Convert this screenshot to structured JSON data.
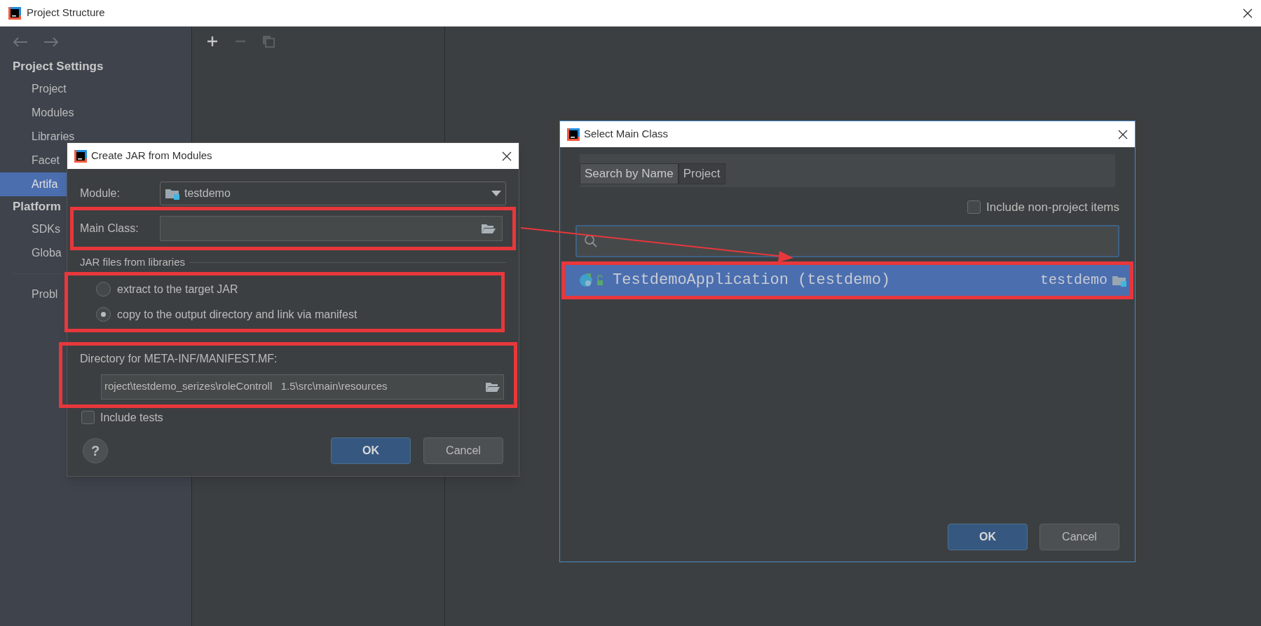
{
  "window": {
    "title": "Project Structure"
  },
  "sidebar": {
    "sections": [
      {
        "title": "Project Settings",
        "items": [
          {
            "label": "Project",
            "selected": false
          },
          {
            "label": "Modules",
            "selected": false
          },
          {
            "label": "Libraries",
            "selected": false
          },
          {
            "label": "Facet",
            "selected": false
          },
          {
            "label": "Artifa",
            "selected": true
          }
        ]
      },
      {
        "title": "Platform",
        "items": [
          {
            "label": "SDKs",
            "selected": false
          },
          {
            "label": "Globa",
            "selected": false
          }
        ]
      }
    ],
    "footer_items": [
      {
        "label": "Probl",
        "selected": false
      }
    ]
  },
  "create_jar_dialog": {
    "title": "Create JAR from Modules",
    "module": {
      "label": "Module:",
      "value": "testdemo"
    },
    "main_class": {
      "label": "Main Class:",
      "highlighted": true
    },
    "libraries": {
      "title": "JAR files from libraries",
      "highlighted": true,
      "options": [
        {
          "label": "extract to the target JAR",
          "selected": false
        },
        {
          "label": "copy to the output directory and link via manifest",
          "selected": true
        }
      ]
    },
    "manifest": {
      "label": "Directory for META-INF/MANIFEST.MF:",
      "value": "roject\\testdemo_serizes\\roleControll   1.5\\src\\main\\resources",
      "highlighted": true
    },
    "include_tests": {
      "label": "Include tests",
      "checked": false
    },
    "help": "?",
    "buttons": [
      {
        "label": "OK",
        "kind": "primary"
      },
      {
        "label": "Cancel",
        "kind": "secondary"
      }
    ]
  },
  "select_main_class_dialog": {
    "title": "Select Main Class",
    "tabs": [
      {
        "label": "Search by Name",
        "selected": true
      },
      {
        "label": "Project",
        "selected": false
      }
    ],
    "include_non_project": {
      "label": "Include non-project items",
      "checked": false
    },
    "results": [
      {
        "name": "TestdemoApplication (testdemo)",
        "module": "testdemo",
        "selected": true,
        "highlighted": true
      }
    ],
    "buttons": [
      {
        "label": "OK",
        "kind": "primary"
      },
      {
        "label": "Cancel",
        "kind": "secondary"
      }
    ]
  },
  "annotation_arrow": true
}
